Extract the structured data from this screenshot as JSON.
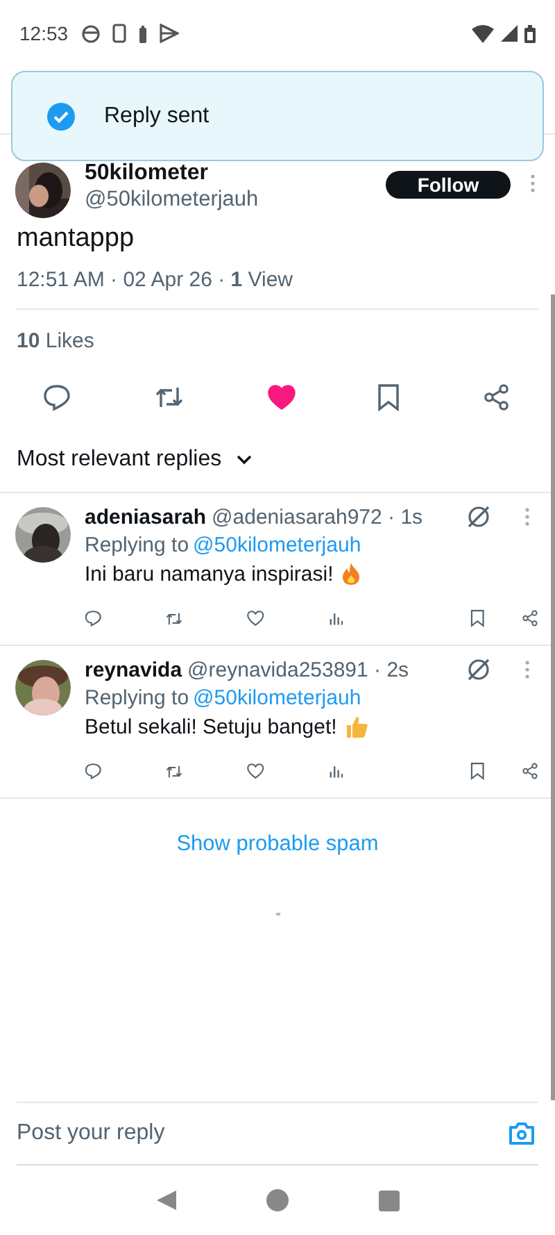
{
  "status_bar": {
    "time": "12:53"
  },
  "toast": {
    "text": "Reply sent"
  },
  "post": {
    "display_name": "50kilometer",
    "handle": "@50kilometerjauh",
    "follow_label": "Follow",
    "text": "mantappp",
    "meta": "12:51 AM · 02 Apr 26 · **1** View",
    "likes": "**10** Likes",
    "liked": true,
    "bookmarked": false
  },
  "sort": {
    "label": "Most relevant replies"
  },
  "replies": [
    {
      "name": "adeniasarah",
      "handle": "@adeniasarah972 · 1s",
      "replying_prefix": "Replying to",
      "replying_to": "@50kilometerjauh",
      "text": "Ini baru namanya inspirasi!",
      "kind": "fire",
      "liked": false,
      "bookmarked": false
    },
    {
      "name": "reynavida",
      "handle": "@reynavida253891 · 2s",
      "replying_prefix": "Replying to",
      "replying_to": "@50kilometerjauh",
      "text": "Betul sekali! Setuju banget!",
      "kind": "thumbs_up",
      "liked": false,
      "bookmarked": false
    }
  ],
  "spam_link": "Show probable spam",
  "reply_bar": {
    "placeholder": "Post your reply"
  }
}
